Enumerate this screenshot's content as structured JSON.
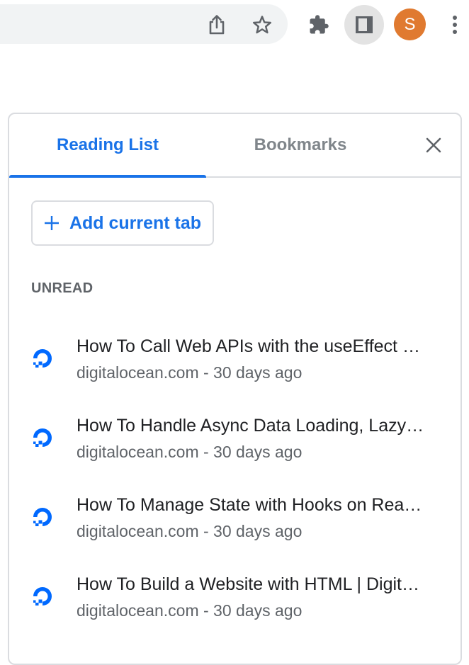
{
  "toolbar": {
    "icons": [
      "share-icon",
      "bookmark-star-icon",
      "extensions-icon",
      "side-panel-icon",
      "more-menu-icon"
    ],
    "avatar_initial": "S",
    "avatar_color": "#e07a30"
  },
  "panel": {
    "tabs": [
      {
        "label": "Reading List",
        "active": true
      },
      {
        "label": "Bookmarks",
        "active": false
      }
    ],
    "close_icon": "close-icon",
    "add_button_label": "Add current tab",
    "section_heading": "UNREAD",
    "items": [
      {
        "title": "How To Call Web APIs with the useEffect Hook in React",
        "display_title": "How To Call Web APIs with the useEffect …",
        "meta": "digitalocean.com - 30 days ago",
        "favicon": "digitalocean-logo-icon"
      },
      {
        "title": "How To Handle Async Data Loading, Lazy Loading, and Code Splitting with React",
        "display_title": "How To Handle Async Data Loading, Lazy…",
        "meta": "digitalocean.com - 30 days ago",
        "favicon": "digitalocean-logo-icon"
      },
      {
        "title": "How To Manage State with Hooks on React Components",
        "display_title": "How To Manage State with Hooks on Rea…",
        "meta": "digitalocean.com - 30 days ago",
        "favicon": "digitalocean-logo-icon"
      },
      {
        "title": "How To Build a Website with HTML | DigitalOcean",
        "display_title": "How To Build a Website with HTML | Digit…",
        "meta": "digitalocean.com - 30 days ago",
        "favicon": "digitalocean-logo-icon"
      }
    ]
  },
  "colors": {
    "accent": "#1a73e8",
    "text_primary": "#202124",
    "text_secondary": "#5f6368",
    "tab_inactive": "#80868b",
    "border": "#dadce0",
    "favicon": "#0069ff"
  }
}
